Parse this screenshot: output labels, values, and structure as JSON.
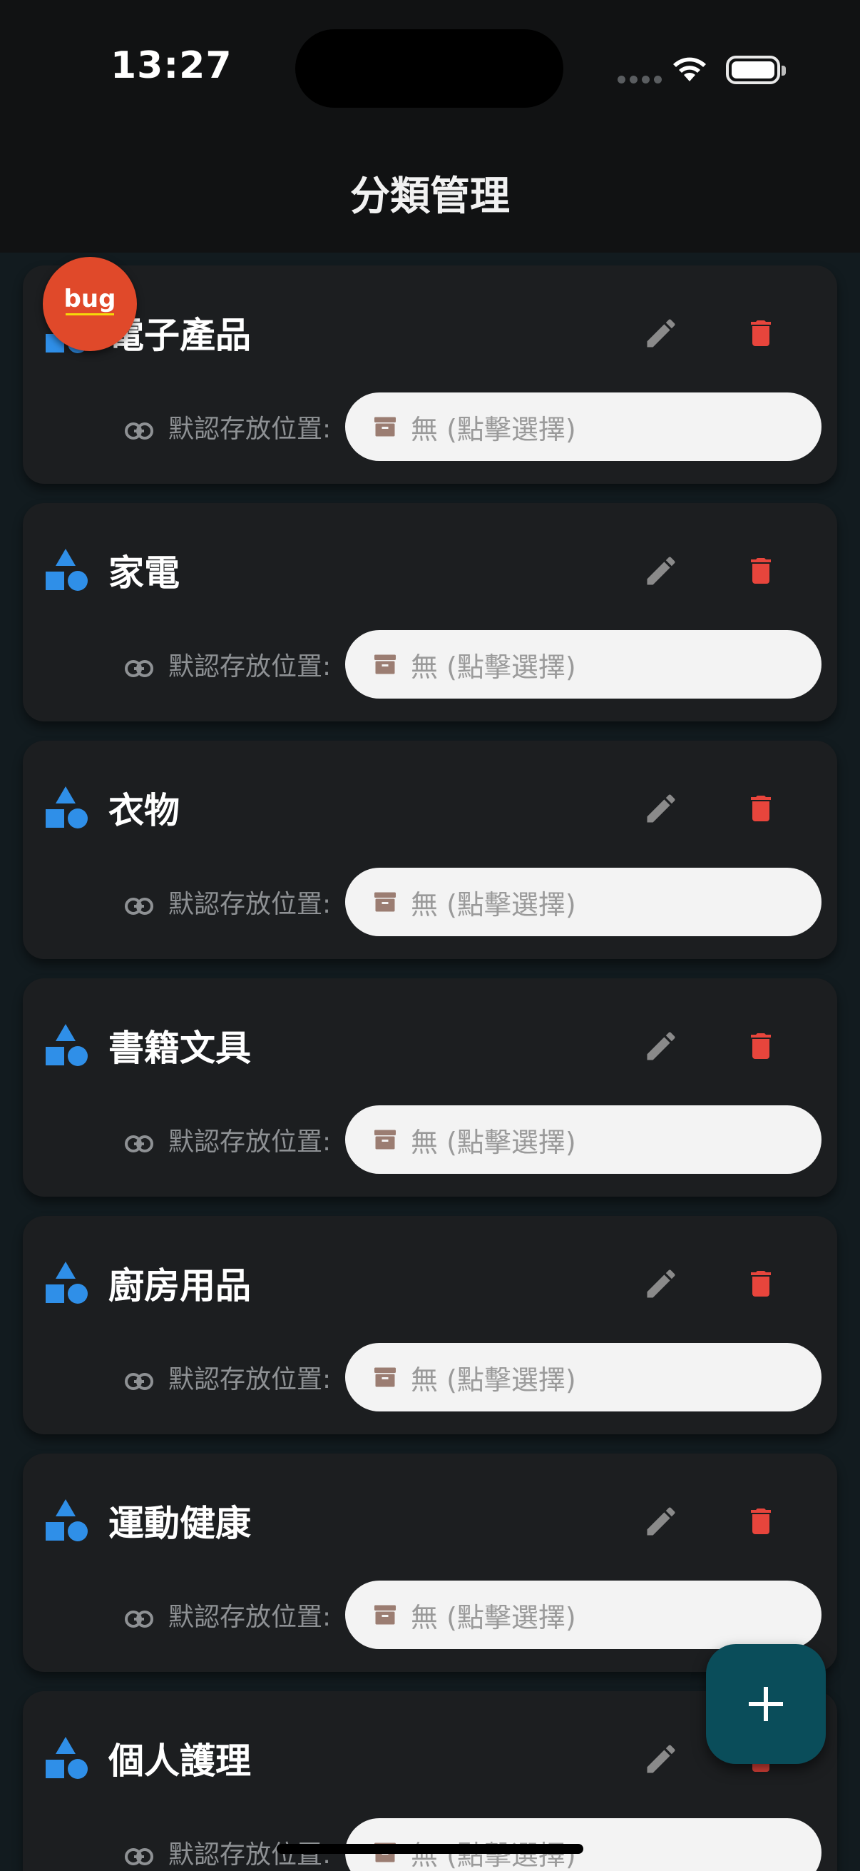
{
  "status_bar": {
    "time": "13:27"
  },
  "header": {
    "title": "分類管理"
  },
  "location_label": "默認存放位置:",
  "categories": [
    {
      "name": "電子產品",
      "location": "無 (點擊選擇)"
    },
    {
      "name": "家電",
      "location": "無 (點擊選擇)"
    },
    {
      "name": "衣物",
      "location": "無 (點擊選擇)"
    },
    {
      "name": "書籍文具",
      "location": "無 (點擊選擇)"
    },
    {
      "name": "廚房用品",
      "location": "無 (點擊選擇)"
    },
    {
      "name": "運動健康",
      "location": "無 (點擊選擇)"
    },
    {
      "name": "個人護理",
      "location": "無 (點擊選擇)"
    }
  ],
  "debug_badge": {
    "label": "bug"
  },
  "icons": {
    "category": "category-shapes-icon",
    "edit": "pencil-icon",
    "delete": "trash-icon",
    "link": "link-icon",
    "location": "archive-box-icon",
    "add": "plus-icon"
  },
  "colors": {
    "accent_blue": "#2f8fe8",
    "delete_red": "#e8453c",
    "fab": "#0a4d5a",
    "badge": "#e0492a",
    "box_icon": "#9b7d72"
  }
}
